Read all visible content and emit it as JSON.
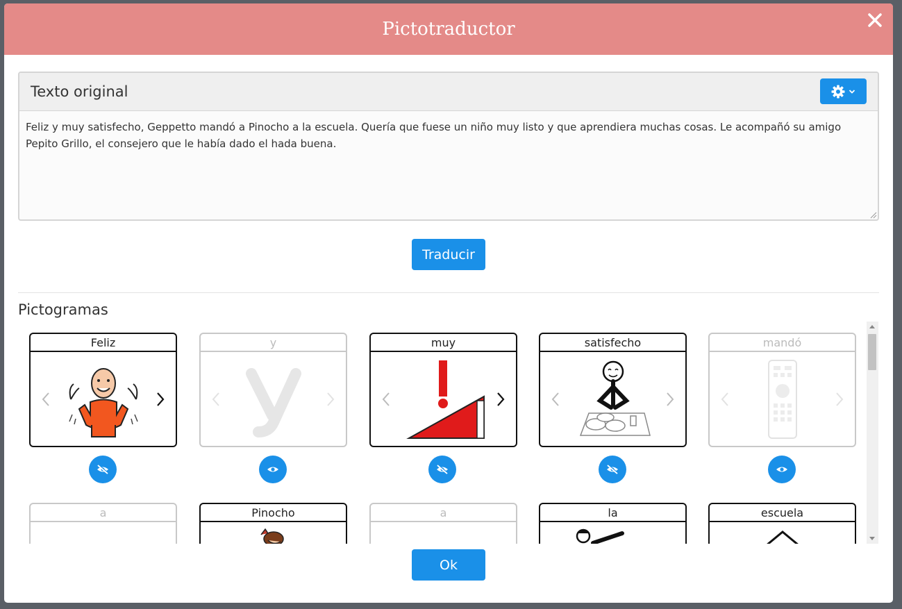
{
  "modal": {
    "title": "Pictotraductor"
  },
  "original": {
    "title": "Texto original",
    "text": "Feliz y muy satisfecho, Geppetto mandó a Pinocho a la escuela. Quería que fuese un niño muy listo y que aprendiera muchas cosas. Le acompañó su amigo Pepito Grillo, el consejero que le había dado el hada buena."
  },
  "buttons": {
    "translate": "Traducir",
    "ok": "Ok"
  },
  "pictograms": {
    "title": "Pictogramas",
    "row1": [
      {
        "word": "Feliz",
        "active": true,
        "icon": "happy-person-icon"
      },
      {
        "word": "y",
        "active": false,
        "icon": "letter-y-icon"
      },
      {
        "word": "muy",
        "active": true,
        "icon": "exclamation-ramp-icon"
      },
      {
        "word": "satisfecho",
        "active": true,
        "icon": "satisfied-diner-icon"
      },
      {
        "word": "mandó",
        "active": false,
        "icon": "remote-control-icon"
      }
    ],
    "row2": [
      {
        "word": "a",
        "active": false
      },
      {
        "word": "Pinocho",
        "active": true
      },
      {
        "word": "a",
        "active": false
      },
      {
        "word": "la",
        "active": true
      },
      {
        "word": "escuela",
        "active": true
      }
    ]
  },
  "colors": {
    "header": "#e48a88",
    "accent": "#1a90e8"
  }
}
